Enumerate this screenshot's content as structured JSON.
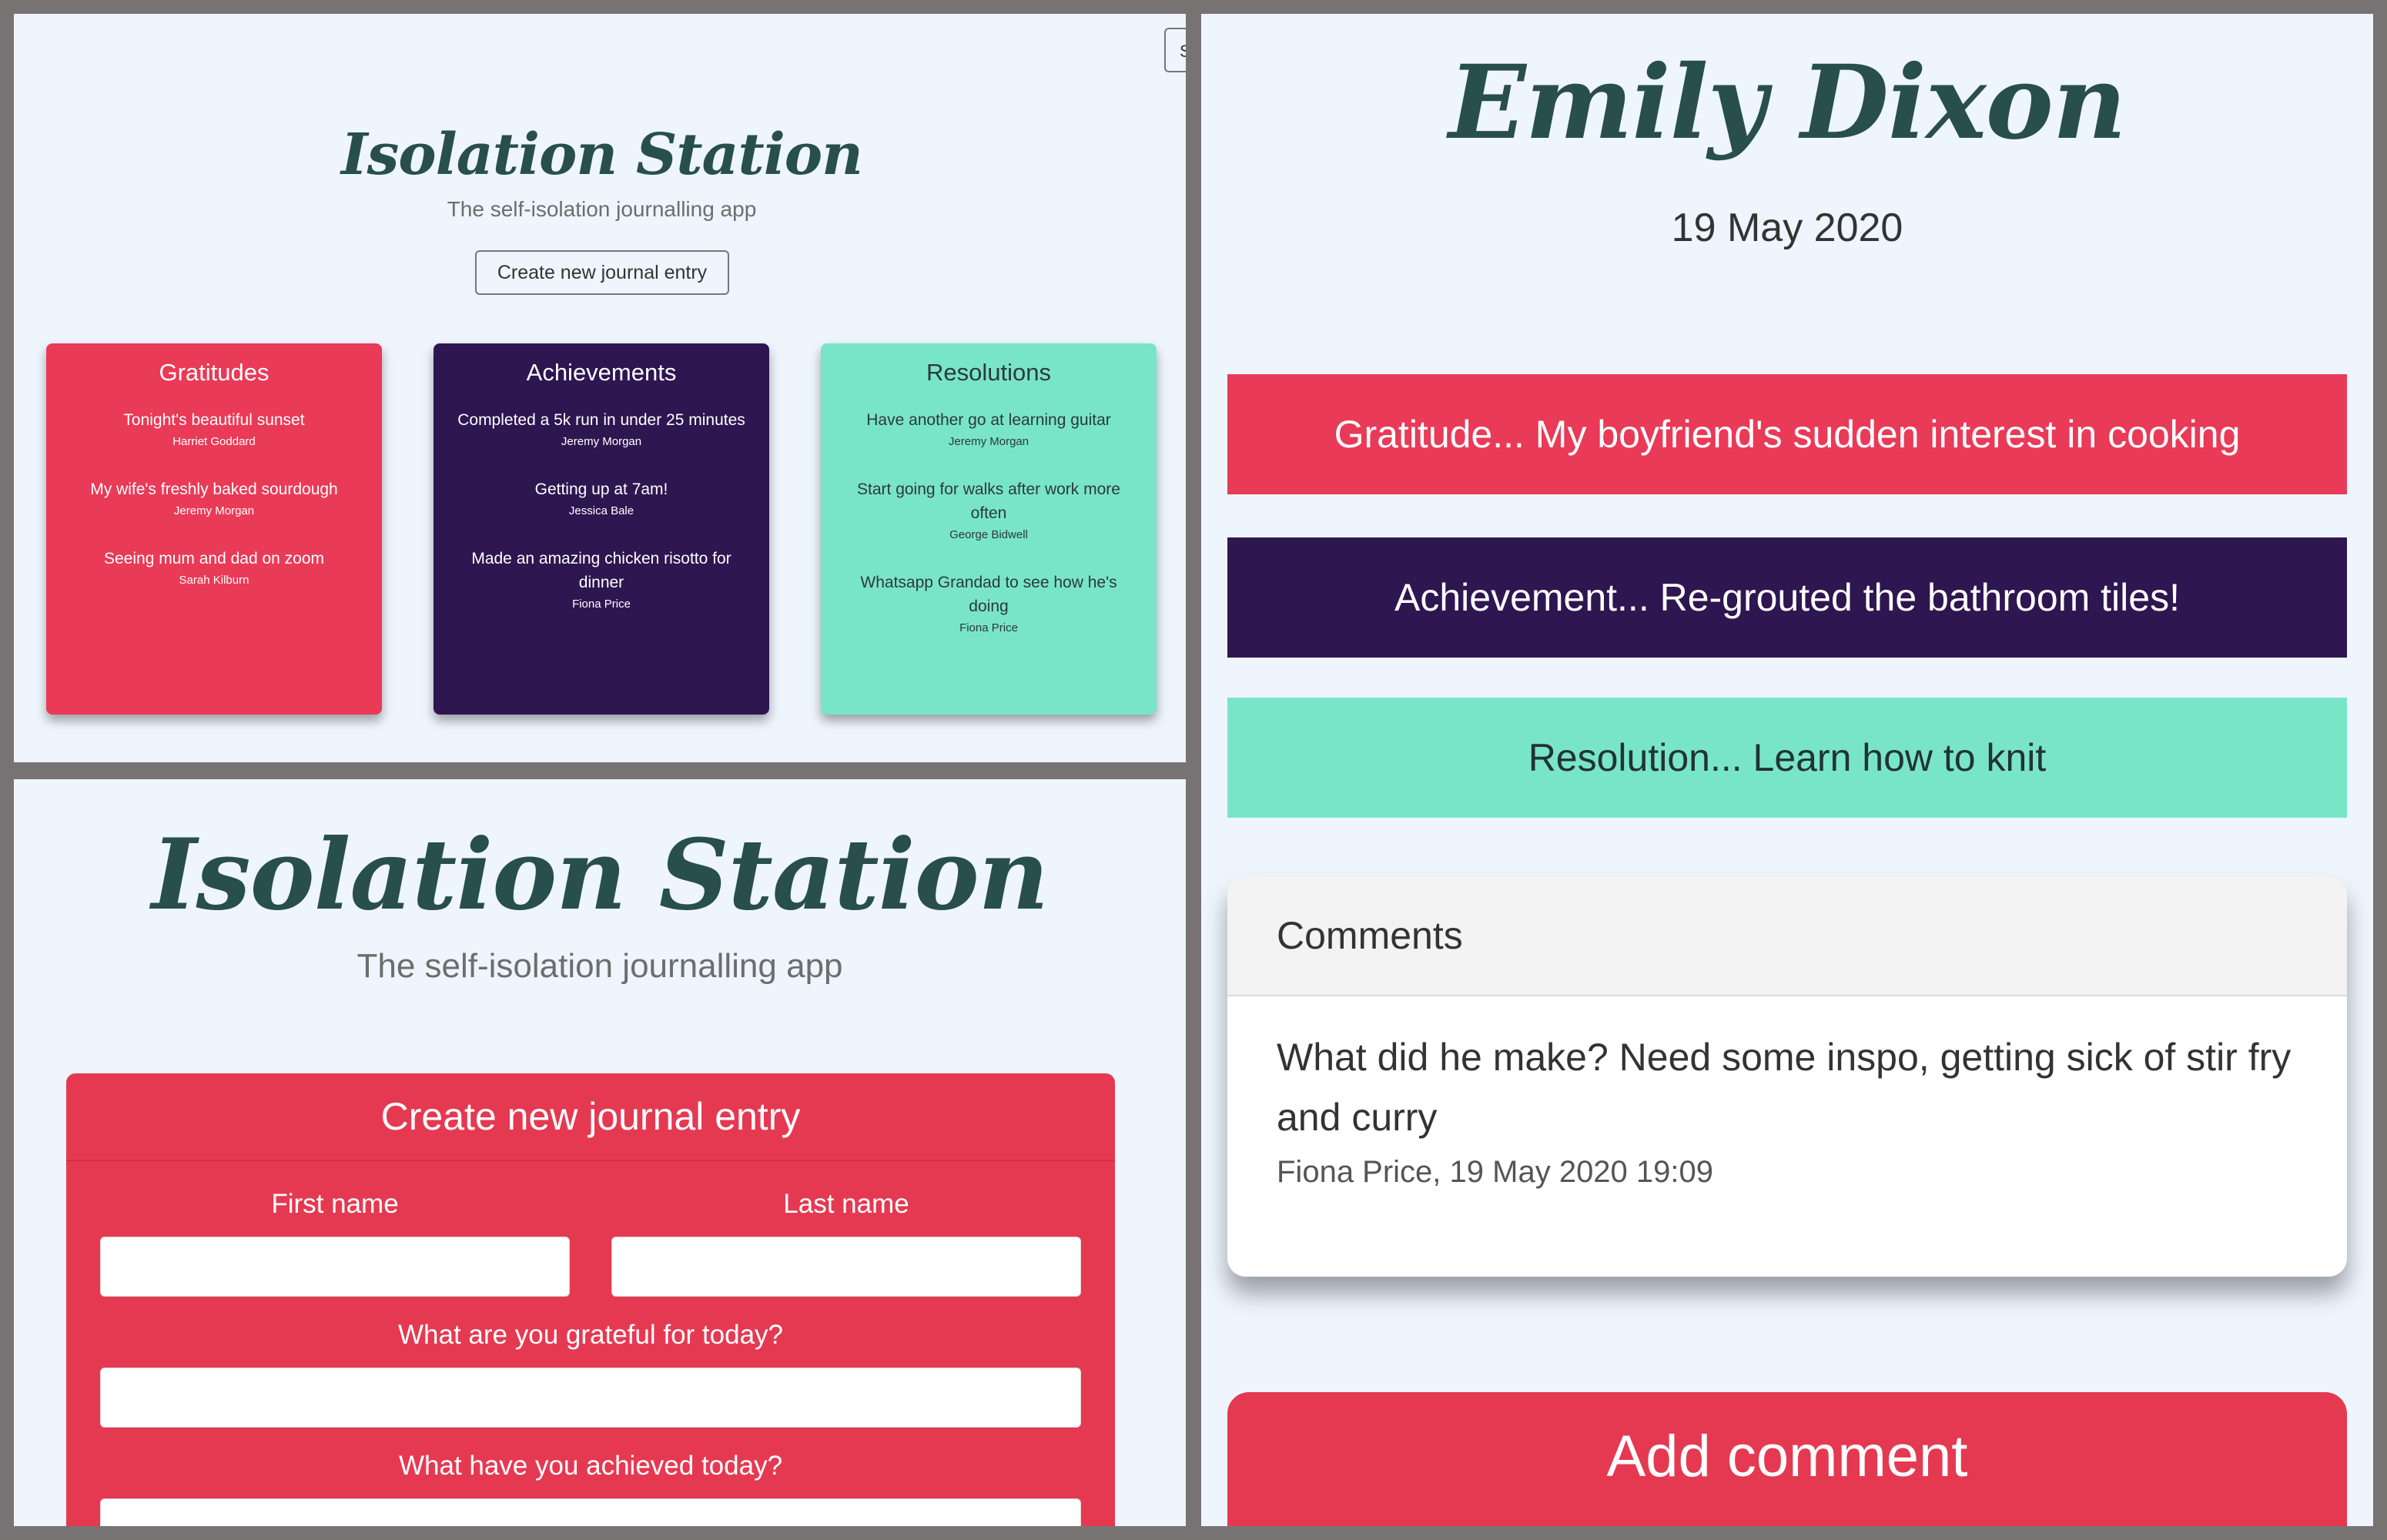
{
  "home": {
    "title": "Isolation Station",
    "tagline": "The self-isolation journalling app",
    "create_button": "Create new journal entry",
    "edge_button": "S",
    "cards": [
      {
        "title": "Gratitudes",
        "entries": [
          {
            "text": "Tonight's beautiful sunset",
            "author": "Harriet Goddard"
          },
          {
            "text": "My wife's freshly baked sourdough",
            "author": "Jeremy Morgan"
          },
          {
            "text": "Seeing mum and dad on zoom",
            "author": "Sarah Kilburn"
          }
        ]
      },
      {
        "title": "Achievements",
        "entries": [
          {
            "text": "Completed a 5k run in under 25 minutes",
            "author": "Jeremy Morgan"
          },
          {
            "text": "Getting up at 7am!",
            "author": "Jessica Bale"
          },
          {
            "text": "Made an amazing chicken risotto for dinner",
            "author": "Fiona Price"
          }
        ]
      },
      {
        "title": "Resolutions",
        "entries": [
          {
            "text": "Have another go at learning guitar",
            "author": "Jeremy Morgan"
          },
          {
            "text": "Start going for walks after work more often",
            "author": "George Bidwell"
          },
          {
            "text": "Whatsapp Grandad to see how he's doing",
            "author": "Fiona Price"
          }
        ]
      }
    ],
    "colors": {
      "gratitude": "#e93a57",
      "achievement": "#2e1650",
      "resolution": "#79e5c7",
      "background": "#eef5fd",
      "title": "#284e4d"
    }
  },
  "form": {
    "title": "Isolation Station",
    "tagline": "The self-isolation journalling app",
    "card_title": "Create new journal entry",
    "first_name_label": "First name",
    "last_name_label": "Last name",
    "grateful_label": "What are you grateful for today?",
    "achieved_label": "What have you achieved today?"
  },
  "entry": {
    "name": "Emily Dixon",
    "date": "19 May 2020",
    "gratitude": "Gratitude... My boyfriend's sudden interest in cooking",
    "achievement": "Achievement... Re-grouted the bathroom tiles!",
    "resolution": "Resolution... Learn how to knit",
    "comments_title": "Comments",
    "comment_text": "What did he make? Need some inspo, getting sick of stir fry and curry",
    "comment_meta": "Fiona Price, 19 May 2020 19:09",
    "add_comment": "Add comment"
  }
}
